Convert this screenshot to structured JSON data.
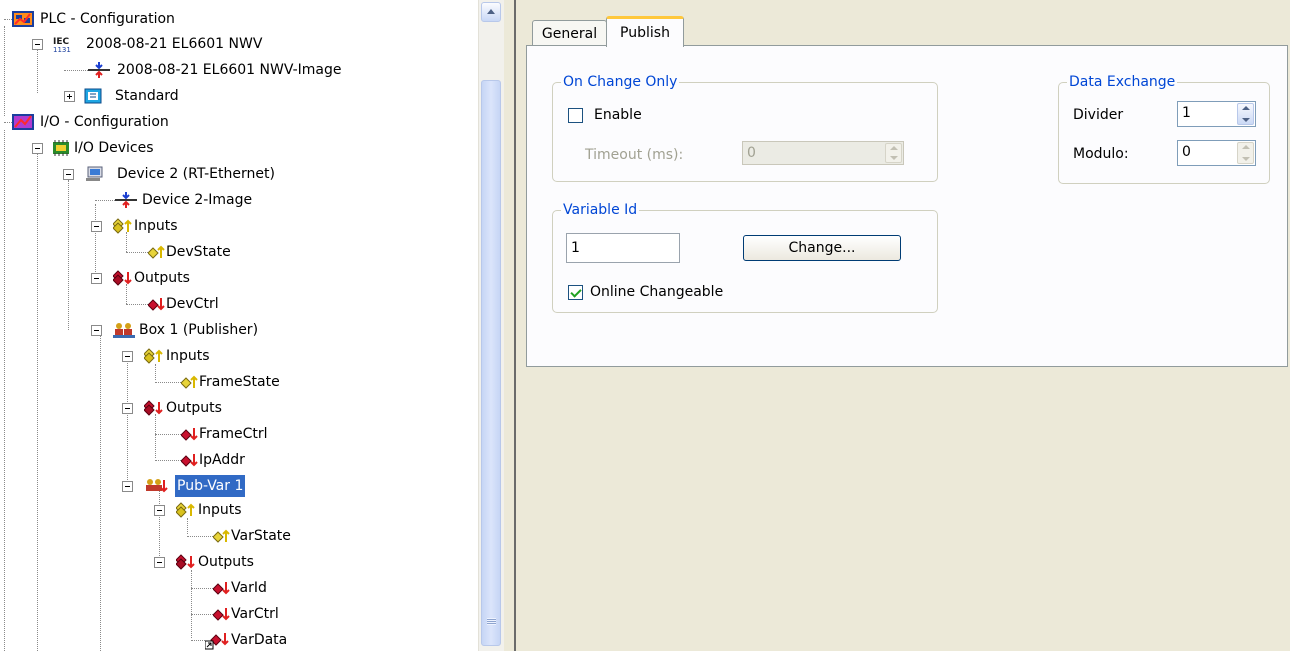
{
  "tree": {
    "plc_configuration": "PLC - Configuration",
    "plc_project": "2008-08-21 EL6601 NWV",
    "plc_image": "2008-08-21 EL6601 NWV-Image",
    "plc_standard": "Standard",
    "io_configuration": "I/O - Configuration",
    "io_devices": "I/O Devices",
    "device2": "Device 2 (RT-Ethernet)",
    "device2_image": "Device 2-Image",
    "device_inputs": "Inputs",
    "devstate": "DevState",
    "device_outputs": "Outputs",
    "devctrl": "DevCtrl",
    "box1": "Box 1 (Publisher)",
    "box_inputs": "Inputs",
    "framestate": "FrameState",
    "box_outputs": "Outputs",
    "framectrl": "FrameCtrl",
    "ipaddr": "IpAddr",
    "pubvar1": "Pub-Var 1",
    "pub_inputs": "Inputs",
    "varstate": "VarState",
    "pub_outputs": "Outputs",
    "varid": "VarId",
    "varctrl": "VarCtrl",
    "vardata": "VarData"
  },
  "tabs": {
    "general": "General",
    "publish": "Publish"
  },
  "on_change": {
    "title": "On Change Only",
    "enable_label": "Enable",
    "enable_checked": false,
    "timeout_label": "Timeout (ms):",
    "timeout_value": "0"
  },
  "data_exchange": {
    "title": "Data Exchange",
    "divider_label": "Divider",
    "divider_value": "1",
    "modulo_label": "Modulo:",
    "modulo_value": "0"
  },
  "variable_id": {
    "title": "Variable Id",
    "value": "1",
    "change_button": "Change...",
    "online_label": "Online Changeable",
    "online_checked": true
  },
  "colors": {
    "group_title": "#0046d5",
    "selection": "#316ac5",
    "tab_highlight": "#ffc83c",
    "pane_background": "#ece9d8"
  }
}
